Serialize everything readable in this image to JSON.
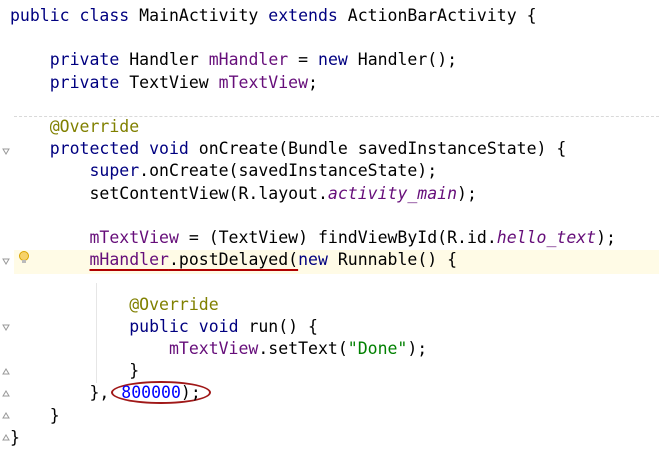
{
  "editor": {
    "lines": {
      "l1": {
        "kw1": "public ",
        "kw2": "class ",
        "t1": "MainActivity ",
        "kw3": "extends ",
        "t2": "ActionBarActivity {"
      },
      "l3": {
        "ind": "    ",
        "kw1": "private ",
        "t1": "Handler ",
        "f1": "mHandler",
        "t2": " = ",
        "kw2": "new ",
        "t3": "Handler();"
      },
      "l4": {
        "ind": "    ",
        "kw1": "private ",
        "t1": "TextView ",
        "f1": "mTextView",
        "t2": ";"
      },
      "l6": {
        "ind": "    ",
        "ann": "@Override"
      },
      "l7": {
        "ind": "    ",
        "kw1": "protected ",
        "kw2": "void ",
        "t1": "onCreate(Bundle savedInstanceState) {"
      },
      "l8": {
        "ind": "        ",
        "kw1": "super",
        "t1": ".onCreate(savedInstanceState);"
      },
      "l9": {
        "ind": "        ",
        "t1": "setContentView(R.layout.",
        "f1": "activity_main",
        "t2": ");"
      },
      "l11": {
        "ind": "        ",
        "f1": "mTextView",
        "t1": " = (TextView) findViewById(R.id.",
        "f2": "hello_text",
        "t2": ");"
      },
      "l12": {
        "ind": "        ",
        "f1": "mHandler",
        "t1": ".postDelayed(",
        "kw1": "new ",
        "t2": "Runnable() {"
      },
      "l14": {
        "ind": "            ",
        "ann": "@Override"
      },
      "l15": {
        "ind": "            ",
        "kw1": "public ",
        "kw2": "void ",
        "t1": "run() {"
      },
      "l16": {
        "ind": "                ",
        "f1": "mTextView",
        "t1": ".setText(",
        "s1": "\"Done\"",
        "t2": ");"
      },
      "l17": {
        "ind": "            ",
        "t1": "}"
      },
      "l18": {
        "ind": "        ",
        "t1": "}, ",
        "n1": "800000",
        "t2": ");"
      },
      "l19": {
        "ind": "    ",
        "t1": "}"
      },
      "l20": {
        "t1": "}"
      }
    }
  },
  "colors": {
    "keyword": "#000080",
    "annotation": "#808000",
    "field": "#660e7a",
    "string": "#008000",
    "number": "#0000ff",
    "highlight": "#b00000"
  },
  "icons": {
    "fold": "fold-marker-icon",
    "bulb": "lightbulb-icon"
  }
}
